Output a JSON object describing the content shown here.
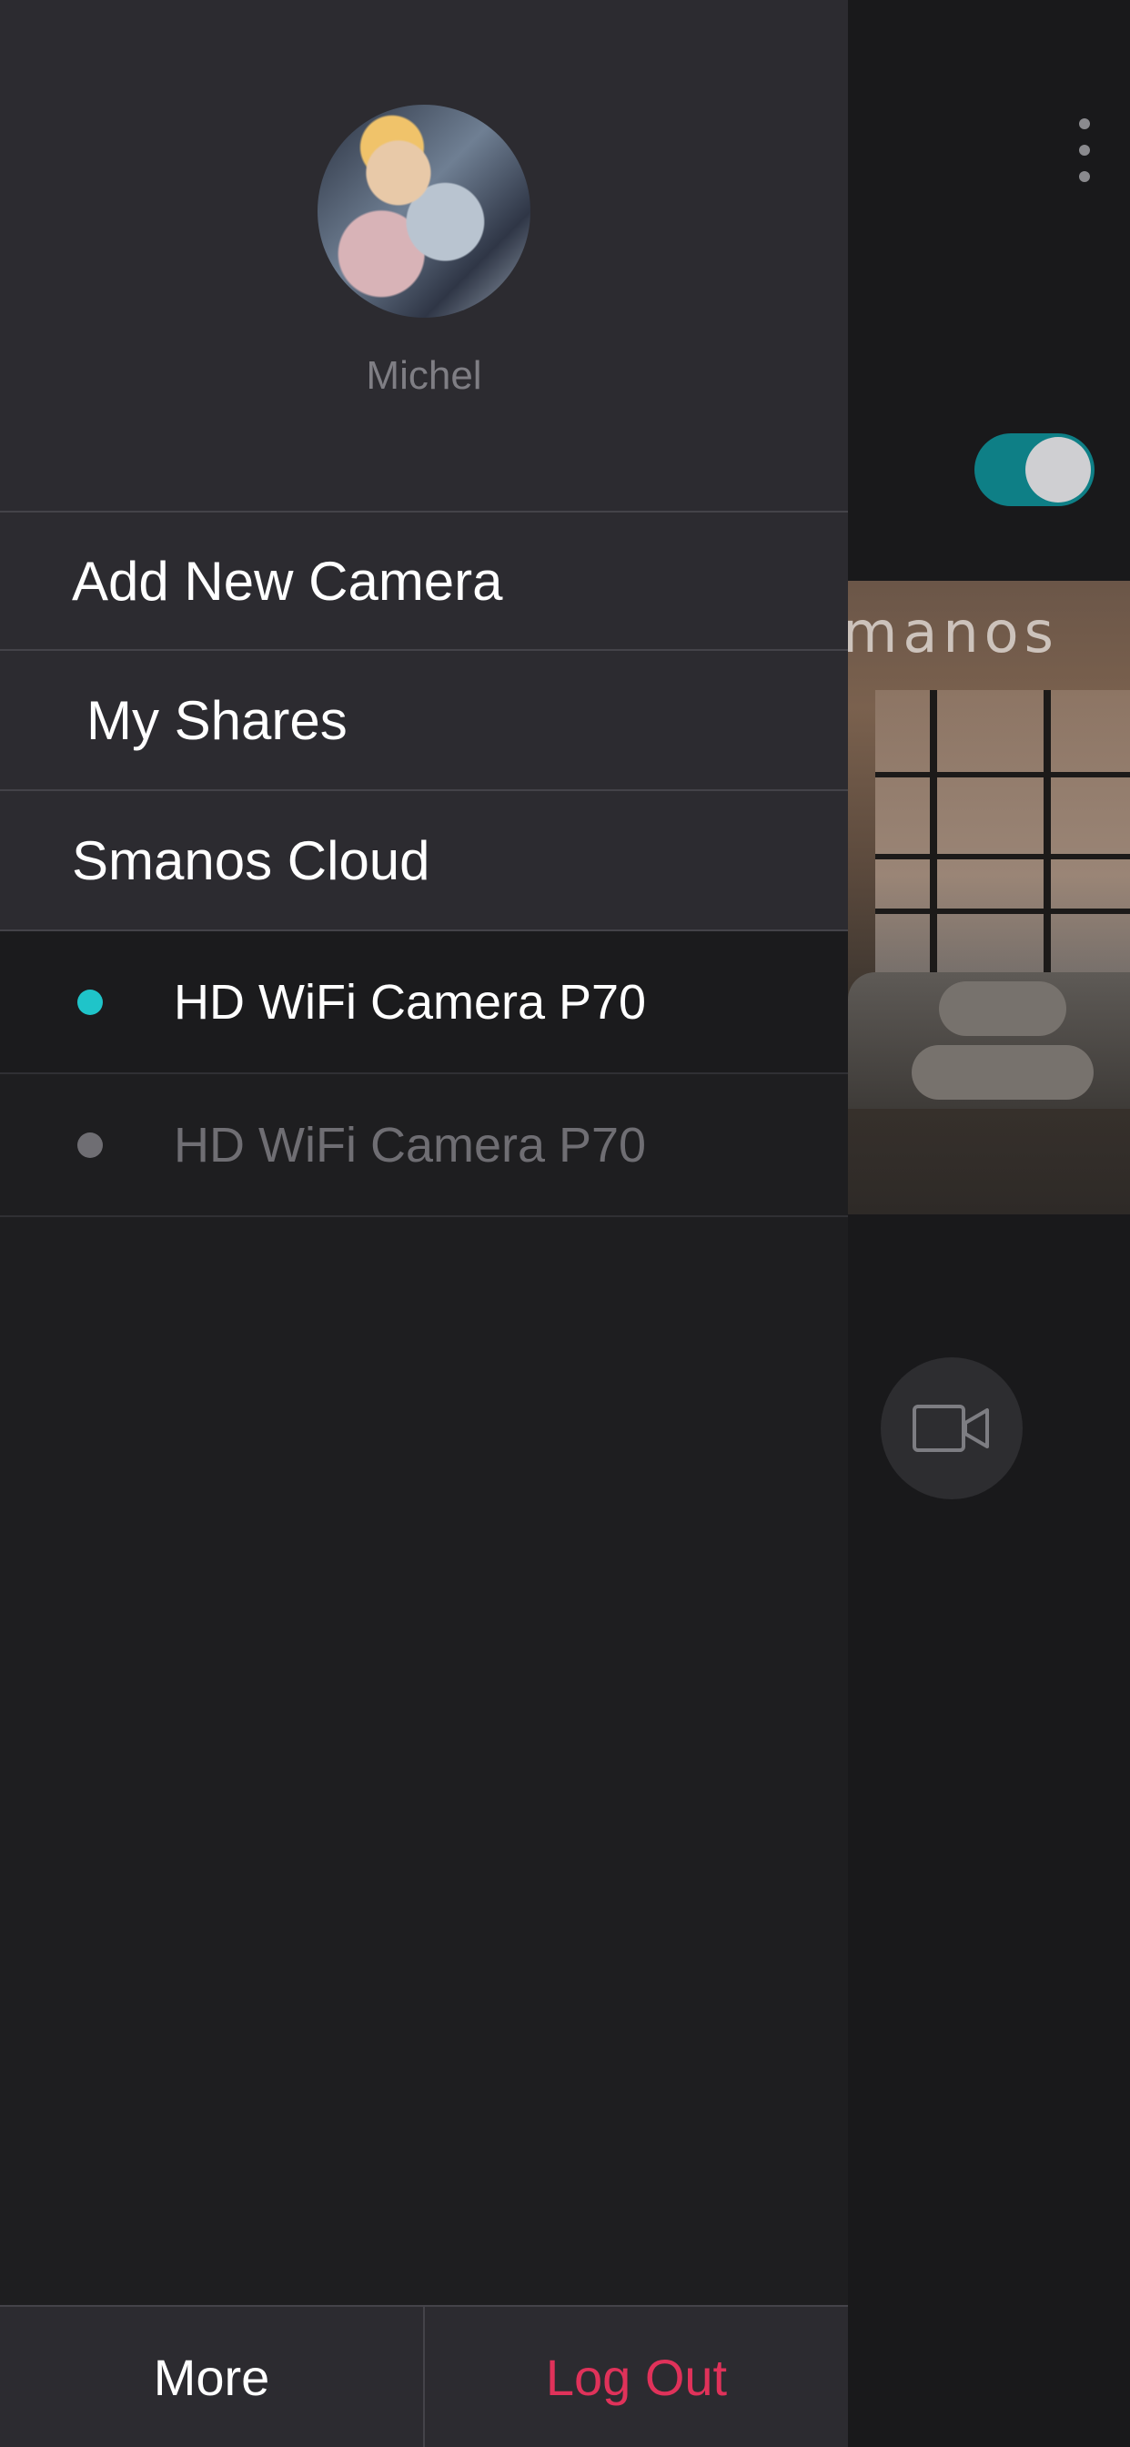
{
  "background": {
    "brand_watermark": "manos",
    "toggle_state": "on",
    "colors": {
      "toggle_track": "#0e7f86",
      "toggle_knob": "#cfcfd2"
    }
  },
  "drawer": {
    "user": {
      "name": "Michel"
    },
    "menu": [
      {
        "label": "Add New Camera"
      },
      {
        "label": "My Shares"
      },
      {
        "label": "Smanos Cloud"
      }
    ],
    "cameras": [
      {
        "label": "HD WiFi Camera P70",
        "status": "online",
        "dot_color": "#1fc4c9",
        "text_color": "#ffffff"
      },
      {
        "label": "HD WiFi Camera P70",
        "status": "offline",
        "dot_color": "#6f6e73",
        "text_color": "#6f6e73"
      }
    ],
    "bottom": {
      "more_label": "More",
      "logout_label": "Log Out"
    },
    "colors": {
      "logout": "#e0325a",
      "header_bg": "#2c2b30"
    }
  },
  "icons": [
    "more-vertical-icon",
    "video-camera-icon"
  ]
}
